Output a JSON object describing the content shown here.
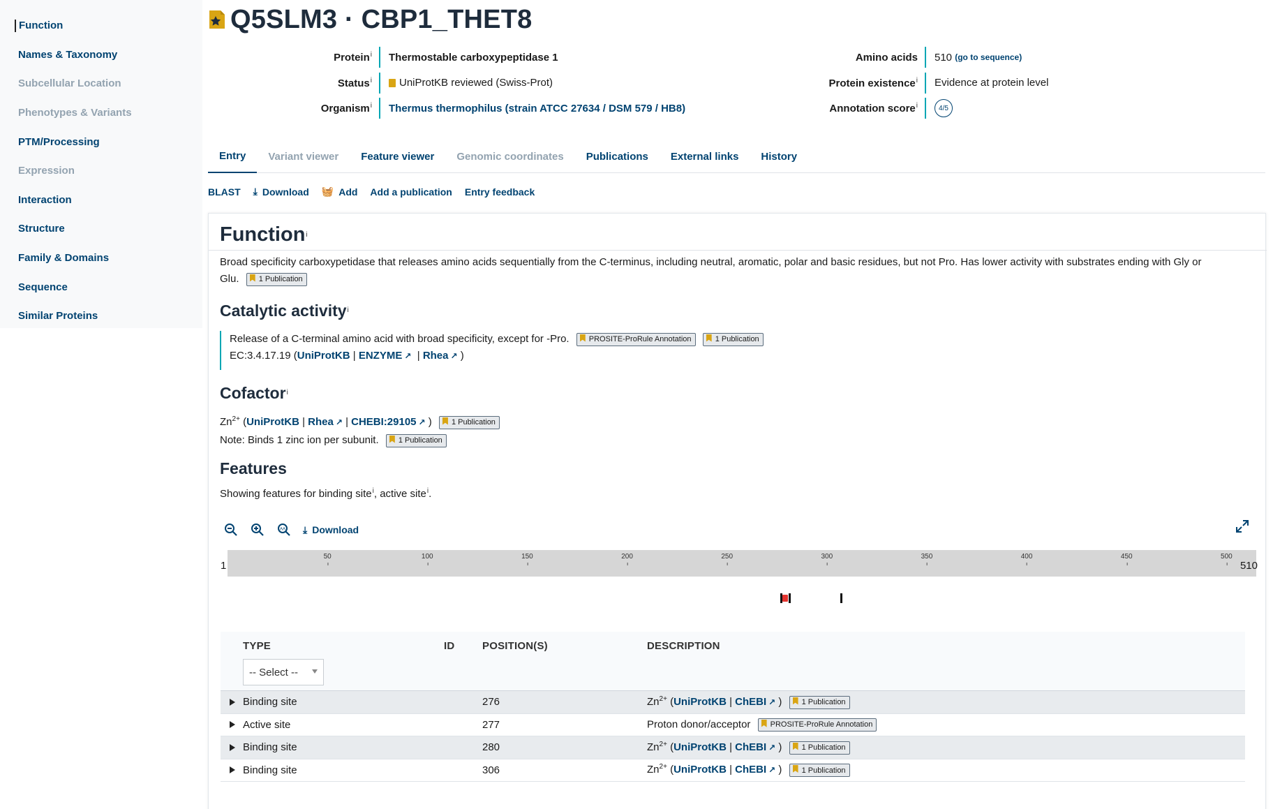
{
  "sidebar": {
    "items": [
      {
        "label": "Function"
      },
      {
        "label": "Names & Taxonomy"
      },
      {
        "label": "Subcellular Location"
      },
      {
        "label": "Phenotypes & Variants"
      },
      {
        "label": "PTM/Processing"
      },
      {
        "label": "Expression"
      },
      {
        "label": "Interaction"
      },
      {
        "label": "Structure"
      },
      {
        "label": "Family & Domains"
      },
      {
        "label": "Sequence"
      },
      {
        "label": "Similar Proteins"
      }
    ]
  },
  "header": {
    "title": "Q5SLM3 · CBP1_THET8",
    "protein_label": "Protein",
    "protein_value": "Thermostable carboxypeptidase 1",
    "status_label": "Status",
    "status_value": "UniProtKB reviewed (Swiss-Prot)",
    "organism_label": "Organism",
    "organism_value": "Thermus thermophilus (strain ATCC 27634 / DSM 579 / HB8)",
    "amino_label": "Amino acids",
    "amino_value": "510",
    "amino_link": "(go to sequence)",
    "existence_label": "Protein existence",
    "existence_value": "Evidence at protein level",
    "score_label": "Annotation score",
    "score_value": "4/5",
    "info": "i"
  },
  "tabs": [
    "Entry",
    "Variant viewer",
    "Feature viewer",
    "Genomic coordinates",
    "Publications",
    "External links",
    "History"
  ],
  "actions": {
    "blast": "BLAST",
    "download": "Download",
    "add": "Add",
    "add_publication": "Add a publication",
    "feedback": "Entry feedback"
  },
  "function": {
    "title": "Function",
    "text_1": "Broad specificity carboxypetidase that releases amino acids sequentially from the C-terminus, including neutral, aromatic, polar and basic residues, but not Pro. Has lower activity with substrates ending with Gly or",
    "text_2": "Glu.",
    "pub": "1 Publication"
  },
  "catalytic": {
    "title": "Catalytic activity",
    "text": "Release of a C-terminal amino acid with broad specificity, except for -Pro.",
    "tag_prosite": "PROSITE-ProRule Annotation",
    "tag_pub": "1 Publication",
    "ec_prefix": "EC:3.4.17.19 (",
    "uniprotkb": "UniProtKB",
    "sep": "|",
    "enzyme": "ENZYME",
    "rhea": "Rhea",
    "close": ")"
  },
  "cofactor": {
    "title": "Cofactor",
    "zn": "Zn",
    "zn_charge": "2+",
    "open": "(",
    "uniprotkb": "UniProtKB",
    "rhea": "Rhea",
    "chebi": "CHEBI:29105",
    "close": ")",
    "pub": "1 Publication",
    "note": "Note: Binds 1 zinc ion per subunit.",
    "note_pub": "1 Publication"
  },
  "features": {
    "title": "Features",
    "showing": "Showing features for binding site",
    "sep": ", active site",
    "end": ".",
    "download": "Download",
    "start_label": "1",
    "end_label": "510",
    "ticks": [
      "50",
      "100",
      "150",
      "200",
      "250",
      "300",
      "350",
      "400",
      "450",
      "500"
    ],
    "length": 510,
    "tick_values": [
      50,
      100,
      150,
      200,
      250,
      300,
      350,
      400,
      450,
      500
    ],
    "markers": [
      276,
      277,
      280,
      306
    ]
  },
  "table": {
    "headers": {
      "type": "TYPE",
      "id": "ID",
      "positions": "POSITION(S)",
      "description": "DESCRIPTION"
    },
    "select_placeholder": "-- Select --",
    "rows": [
      {
        "type": "Binding site",
        "position": "276",
        "kind": "zn",
        "pub": "1 Publication"
      },
      {
        "type": "Active site",
        "position": "277",
        "kind": "active",
        "desc": "Proton donor/acceptor",
        "pub": "PROSITE-ProRule Annotation"
      },
      {
        "type": "Binding site",
        "position": "280",
        "kind": "zn",
        "pub": "1 Publication"
      },
      {
        "type": "Binding site",
        "position": "306",
        "kind": "zn",
        "pub": "1 Publication"
      }
    ],
    "zn": "Zn",
    "charge": "2+",
    "uniprotkb": "UniProtKB",
    "chebi": "ChEBI"
  },
  "colors": {
    "accent": "#014371",
    "divider": "#00a6b4",
    "flag": "#d9a514",
    "red_marker": "#e3342f"
  }
}
